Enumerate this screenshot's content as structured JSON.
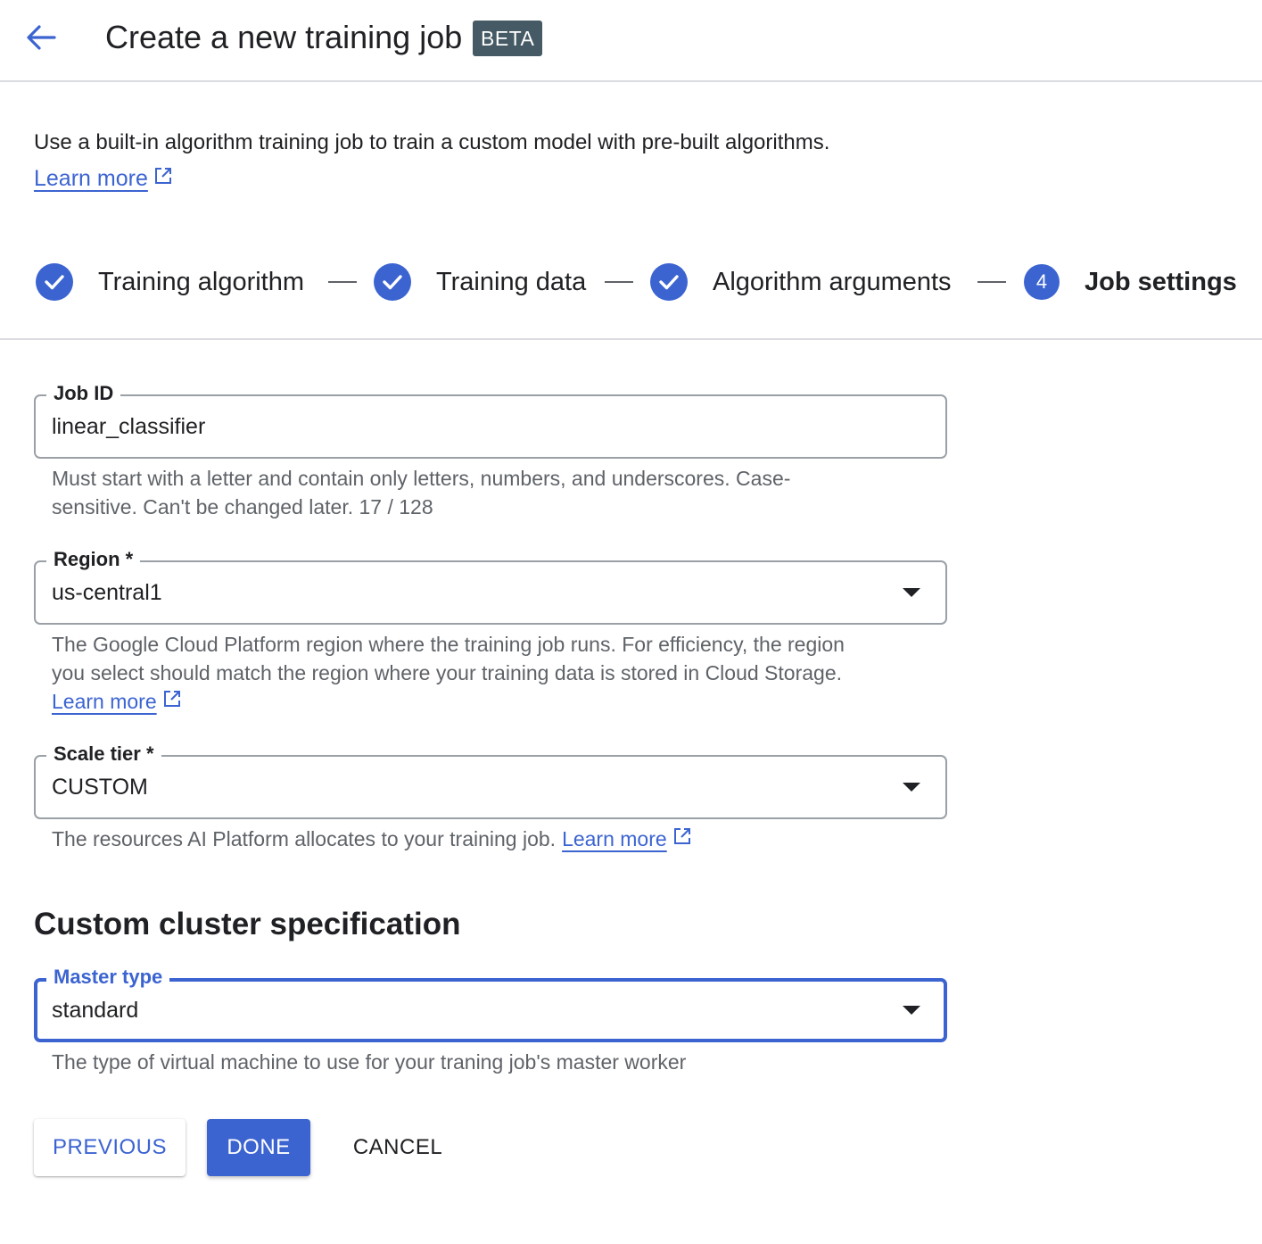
{
  "header": {
    "title": "Create a new training job",
    "badge": "BETA"
  },
  "intro": {
    "text": "Use a built-in algorithm training job to train a custom model with pre-built algorithms.",
    "learn_more": "Learn more"
  },
  "stepper": {
    "steps": [
      {
        "label": "Training algorithm",
        "state": "complete"
      },
      {
        "label": "Training data",
        "state": "complete"
      },
      {
        "label": "Algorithm arguments",
        "state": "complete"
      },
      {
        "label": "Job settings",
        "state": "active",
        "number": "4"
      }
    ]
  },
  "form": {
    "job_id": {
      "label": "Job ID",
      "value": "linear_classifier",
      "hint_line1": "Must start with a letter and contain only letters, numbers, and underscores. Case-",
      "hint_line2": "sensitive. Can't be changed later. 17 / 128"
    },
    "region": {
      "label": "Region *",
      "value": "us-central1",
      "hint_line1": "The Google Cloud Platform region where the training job runs. For efficiency, the region",
      "hint_line2": "you select should match the region where your training data is stored in Cloud Storage.",
      "learn_more": "Learn more"
    },
    "scale_tier": {
      "label": "Scale tier *",
      "value": "CUSTOM",
      "hint": "The resources AI Platform allocates to your training job.",
      "learn_more": "Learn more"
    }
  },
  "custom_cluster": {
    "heading": "Custom cluster specification",
    "master_type": {
      "label": "Master type",
      "value": "standard",
      "hint": "The type of virtual machine to use for your traning job's master worker"
    }
  },
  "actions": {
    "previous": "PREVIOUS",
    "done": "DONE",
    "cancel": "CANCEL"
  },
  "colors": {
    "accent": "#3c64d1",
    "badge_bg": "#455a64",
    "hint_text": "#5f6368"
  }
}
